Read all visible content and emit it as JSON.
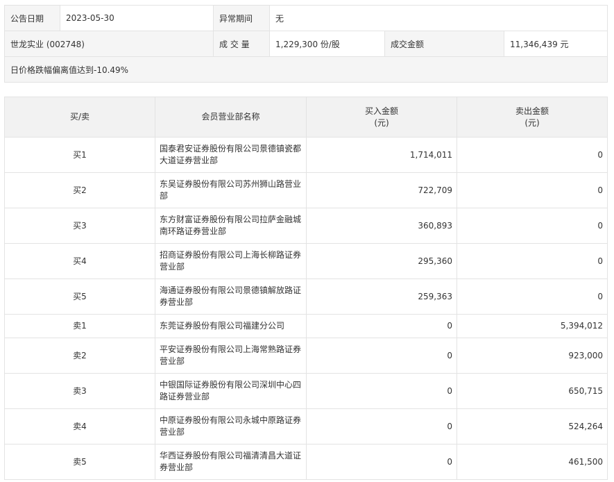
{
  "info": {
    "date_label": "公告日期",
    "date_value": "2023-05-30",
    "period_label": "异常期间",
    "period_value": "无",
    "stock": "世龙实业 (002748)",
    "volume_label": "成 交 量",
    "volume_value": "1,229,300 份/股",
    "amount_label": "成交金额",
    "amount_value": "11,346,439 元",
    "note": "日价格跌幅偏离值达到-10.49%"
  },
  "table": {
    "headers": {
      "side": "买/卖",
      "dept": "会员营业部名称",
      "buy_line1": "买入金额",
      "buy_line2": "(元)",
      "sell_line1": "卖出金额",
      "sell_line2": "(元)"
    },
    "rows": [
      {
        "side": "买1",
        "dept": "国泰君安证券股份有限公司景德镇瓷都大道证券营业部",
        "buy": "1,714,011",
        "sell": "0"
      },
      {
        "side": "买2",
        "dept": "东吴证券股份有限公司苏州狮山路营业部",
        "buy": "722,709",
        "sell": "0"
      },
      {
        "side": "买3",
        "dept": "东方财富证券股份有限公司拉萨金融城南环路证券营业部",
        "buy": "360,893",
        "sell": "0"
      },
      {
        "side": "买4",
        "dept": "招商证券股份有限公司上海长柳路证券营业部",
        "buy": "295,360",
        "sell": "0"
      },
      {
        "side": "买5",
        "dept": "海通证券股份有限公司景德镇解放路证券营业部",
        "buy": "259,363",
        "sell": "0"
      },
      {
        "side": "卖1",
        "dept": "东莞证券股份有限公司福建分公司",
        "buy": "0",
        "sell": "5,394,012"
      },
      {
        "side": "卖2",
        "dept": "平安证券股份有限公司上海常熟路证券营业部",
        "buy": "0",
        "sell": "923,000"
      },
      {
        "side": "卖3",
        "dept": "中银国际证券股份有限公司深圳中心四路证券营业部",
        "buy": "0",
        "sell": "650,715"
      },
      {
        "side": "卖4",
        "dept": "中原证券股份有限公司永城中原路证券营业部",
        "buy": "0",
        "sell": "524,264"
      },
      {
        "side": "卖5",
        "dept": "华西证券股份有限公司福清清昌大道证券营业部",
        "buy": "0",
        "sell": "461,500"
      }
    ]
  }
}
